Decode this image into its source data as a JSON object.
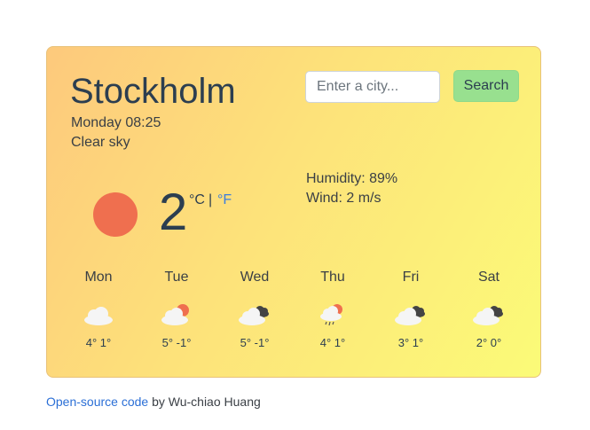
{
  "weather": {
    "city": "Stockholm",
    "datetime": "Monday 08:25",
    "condition": "Clear sky",
    "temperature": "2",
    "unit_c": "°C",
    "unit_sep": "|",
    "unit_f": "°F",
    "humidity": "Humidity: 89%",
    "wind": "Wind: 2 m/s",
    "current_icon": "sun-icon",
    "sun_color": "#ef6f4f"
  },
  "search": {
    "placeholder": "Enter a city...",
    "button_label": "Search"
  },
  "forecast": [
    {
      "day": "Mon",
      "icon": "cloud-icon",
      "temps": "4° 1°"
    },
    {
      "day": "Tue",
      "icon": "cloud-sun-icon",
      "temps": "5° -1°"
    },
    {
      "day": "Wed",
      "icon": "cloud-dark-cloud-icon",
      "temps": "5° -1°"
    },
    {
      "day": "Thu",
      "icon": "cloud-rain-sun-icon",
      "temps": "4° 1°"
    },
    {
      "day": "Fri",
      "icon": "cloud-dark-cloud-icon",
      "temps": "3° 1°"
    },
    {
      "day": "Sat",
      "icon": "cloud-dark-cloud-icon",
      "temps": "2° 0°"
    }
  ],
  "footer": {
    "link_text": "Open-source code",
    "by_text": " by Wu-chiao Huang"
  },
  "colors": {
    "accent_link": "#2b6fd6",
    "button_green": "#98e08f",
    "gradient_start": "#fdc97c",
    "gradient_end": "#fbfb78"
  }
}
